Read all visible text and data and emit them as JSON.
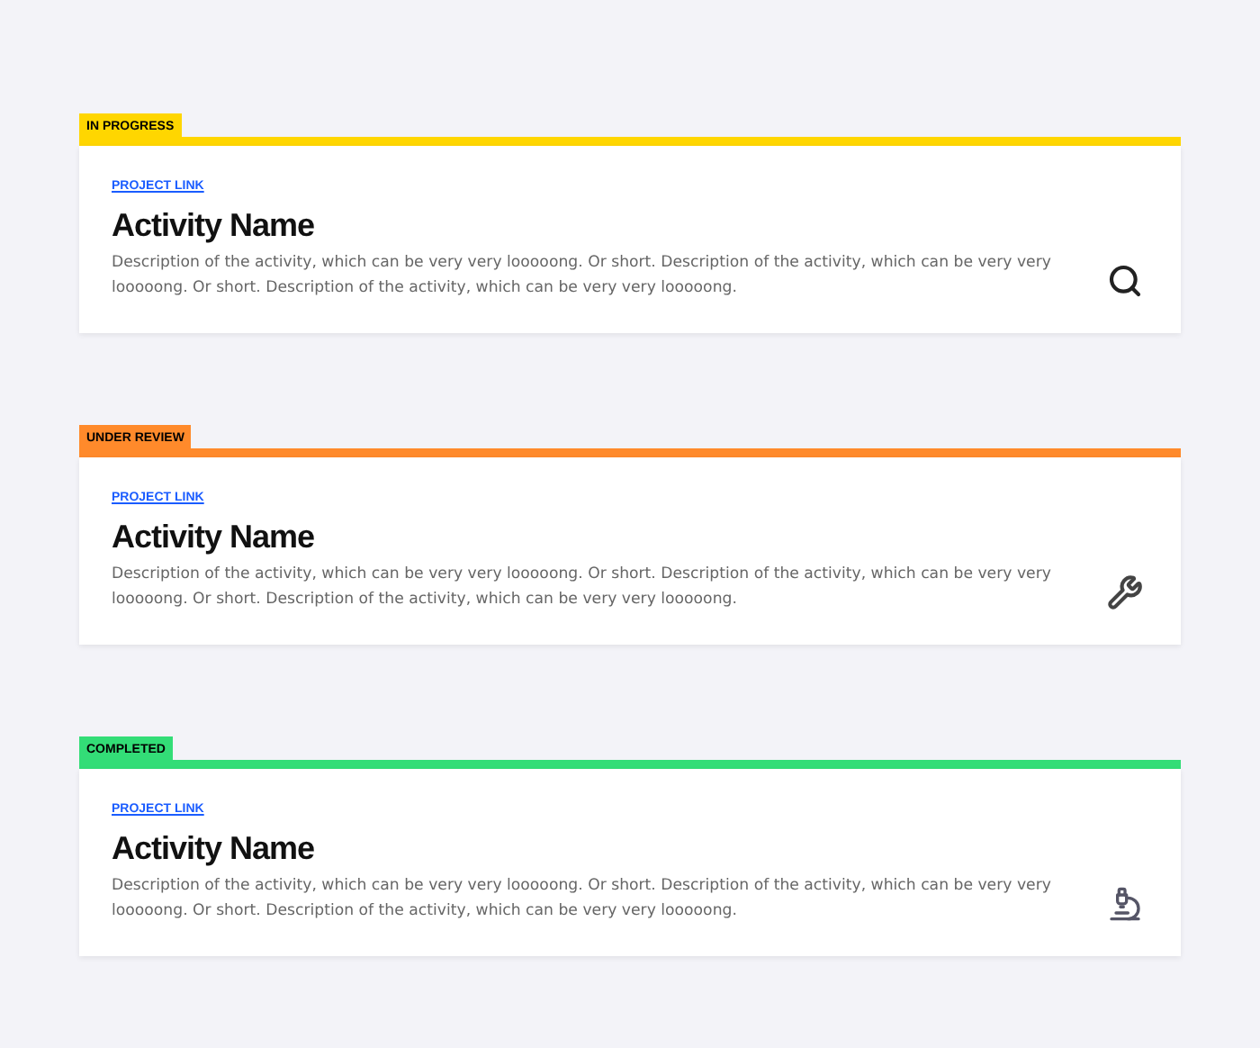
{
  "activities": [
    {
      "status": "IN PROGRESS",
      "kind": "in_progress",
      "color": "#ffd600",
      "link": "PROJECT LINK",
      "title": "Activity Name",
      "description": "Description of the activity, which can be very very looooong. Or short. Description of the activity, which can be very very looooong. Or short. Description of the activity, which can be very very looooong."
    },
    {
      "status": "UNDER REVIEW",
      "kind": "under_review",
      "color": "#ff8a2b",
      "link": "PROJECT LINK",
      "title": "Activity Name",
      "description": "Description of the activity, which can be very very looooong. Or short. Description of the activity, which can be very very looooong. Or short. Description of the activity, which can be very very looooong."
    },
    {
      "status": "COMPLETED",
      "kind": "completed",
      "color": "#33dd77",
      "link": "PROJECT LINK",
      "title": "Activity Name",
      "description": "Description of the activity, which can be very very looooong. Or short. Description of the activity, which can be very very looooong. Or short. Description of the activity, which can be very very looooong."
    }
  ]
}
